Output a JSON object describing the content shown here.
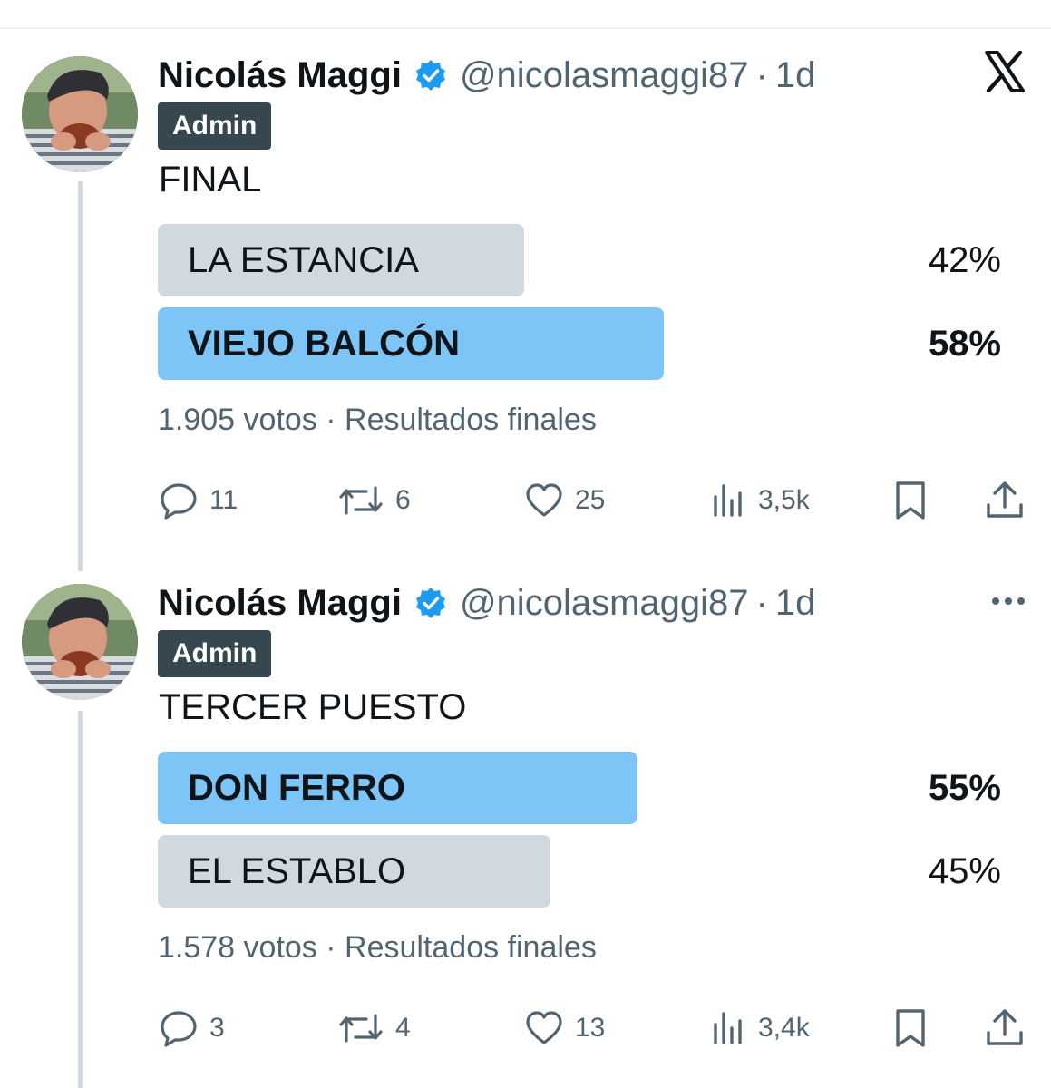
{
  "tweets": [
    {
      "author": {
        "name": "Nicolás Maggi",
        "handle": "@nicolasmaggi87",
        "separator": "·",
        "time": "1d",
        "badge": "Admin"
      },
      "text": "FINAL",
      "poll": {
        "options": [
          {
            "label": "LA ESTANCIA",
            "percent_text": "42%",
            "share": 0.42,
            "winner": false
          },
          {
            "label": "VIEJO BALCÓN",
            "percent_text": "58%",
            "share": 0.58,
            "winner": true
          }
        ],
        "meta": "1.905 votos · Resultados finales"
      },
      "actions": {
        "replies": "11",
        "reposts": "6",
        "likes": "25",
        "views": "3,5k"
      }
    },
    {
      "author": {
        "name": "Nicolás Maggi",
        "handle": "@nicolasmaggi87",
        "separator": "·",
        "time": "1d",
        "badge": "Admin"
      },
      "text": "TERCER PUESTO",
      "poll": {
        "options": [
          {
            "label": "DON FERRO",
            "percent_text": "55%",
            "share": 0.55,
            "winner": true
          },
          {
            "label": "EL ESTABLO",
            "percent_text": "45%",
            "share": 0.45,
            "winner": false
          }
        ],
        "meta": "1.578 votos · Resultados finales"
      },
      "actions": {
        "replies": "3",
        "reposts": "4",
        "likes": "13",
        "views": "3,4k"
      }
    }
  ],
  "icons": {
    "brand": "x-logo-icon",
    "more": "more-icon",
    "reply": "reply-icon",
    "repost": "repost-icon",
    "like": "like-icon",
    "views": "views-icon",
    "bookmark": "bookmark-icon",
    "share": "share-icon",
    "verified": "verified-badge-icon"
  },
  "colors": {
    "winner_bar": "#7dc4f7",
    "loser_bar": "#cfd9de",
    "verified": "#1d9bf0",
    "secondary_text": "#536471",
    "badge_bg": "#37474f"
  }
}
